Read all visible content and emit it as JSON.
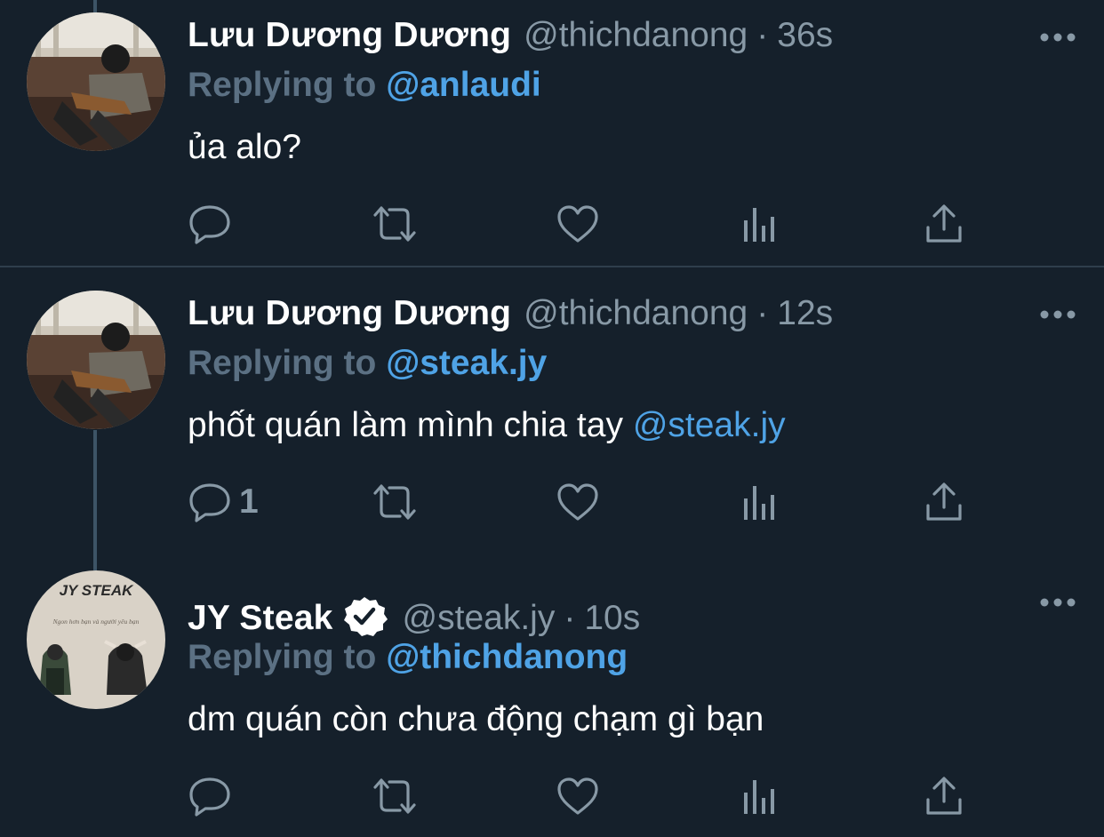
{
  "tweets": [
    {
      "display_name": "Lưu Dương Dương",
      "handle": "@thichdanong",
      "dot": "·",
      "time": "36s",
      "reply_prefix": "Replying to",
      "reply_handle": "@anlaudi",
      "text": "ủa alo?",
      "text_mention": "",
      "reply_count": "",
      "verified": false
    },
    {
      "display_name": "Lưu Dương Dương",
      "handle": "@thichdanong",
      "dot": "·",
      "time": "12s",
      "reply_prefix": "Replying to",
      "reply_handle": "@steak.jy",
      "text": "phốt quán làm mình chia tay",
      "text_mention": "@steak.jy",
      "reply_count": "1",
      "verified": false
    },
    {
      "display_name": "JY Steak",
      "handle": "@steak.jy",
      "dot": "·",
      "time": "10s",
      "reply_prefix": "Replying to",
      "reply_handle": "@thichdanong",
      "text": "dm quán còn chưa động chạm gì bạn",
      "text_mention": "",
      "reply_count": "",
      "verified": true,
      "avatar_logo_text": "JY STEAK",
      "avatar_tagline": "Ngon hơn bạn và người yêu bạn"
    }
  ],
  "colors": {
    "background": "#15202b",
    "secondary_text": "#8899a6",
    "reply_prefix": "#5b7083",
    "link": "#4fa3e6",
    "thread_line": "#3d5466",
    "divider": "#2f3e4c"
  },
  "icons": [
    "reply-icon",
    "retweet-icon",
    "like-icon",
    "analytics-icon",
    "share-icon",
    "more-icon",
    "verified-badge-icon"
  ]
}
